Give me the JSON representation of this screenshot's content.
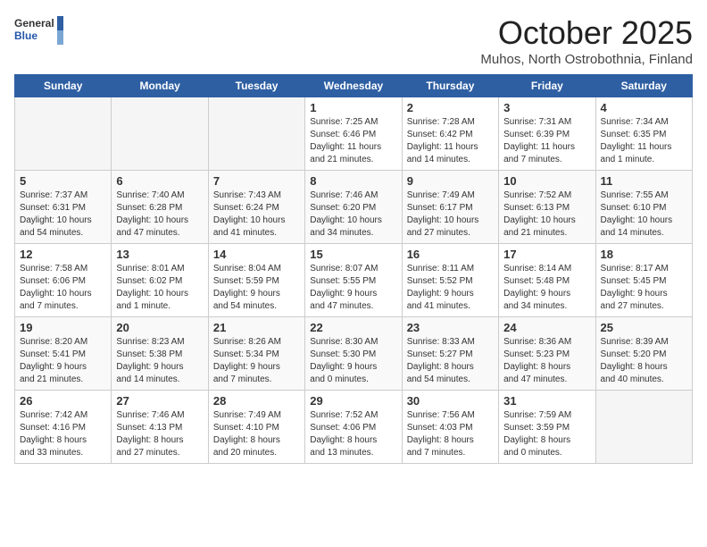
{
  "header": {
    "logo_general": "General",
    "logo_blue": "Blue",
    "month": "October 2025",
    "location": "Muhos, North Ostrobothnia, Finland"
  },
  "days_of_week": [
    "Sunday",
    "Monday",
    "Tuesday",
    "Wednesday",
    "Thursday",
    "Friday",
    "Saturday"
  ],
  "weeks": [
    [
      {
        "day": "",
        "info": ""
      },
      {
        "day": "",
        "info": ""
      },
      {
        "day": "",
        "info": ""
      },
      {
        "day": "1",
        "info": "Sunrise: 7:25 AM\nSunset: 6:46 PM\nDaylight: 11 hours\nand 21 minutes."
      },
      {
        "day": "2",
        "info": "Sunrise: 7:28 AM\nSunset: 6:42 PM\nDaylight: 11 hours\nand 14 minutes."
      },
      {
        "day": "3",
        "info": "Sunrise: 7:31 AM\nSunset: 6:39 PM\nDaylight: 11 hours\nand 7 minutes."
      },
      {
        "day": "4",
        "info": "Sunrise: 7:34 AM\nSunset: 6:35 PM\nDaylight: 11 hours\nand 1 minute."
      }
    ],
    [
      {
        "day": "5",
        "info": "Sunrise: 7:37 AM\nSunset: 6:31 PM\nDaylight: 10 hours\nand 54 minutes."
      },
      {
        "day": "6",
        "info": "Sunrise: 7:40 AM\nSunset: 6:28 PM\nDaylight: 10 hours\nand 47 minutes."
      },
      {
        "day": "7",
        "info": "Sunrise: 7:43 AM\nSunset: 6:24 PM\nDaylight: 10 hours\nand 41 minutes."
      },
      {
        "day": "8",
        "info": "Sunrise: 7:46 AM\nSunset: 6:20 PM\nDaylight: 10 hours\nand 34 minutes."
      },
      {
        "day": "9",
        "info": "Sunrise: 7:49 AM\nSunset: 6:17 PM\nDaylight: 10 hours\nand 27 minutes."
      },
      {
        "day": "10",
        "info": "Sunrise: 7:52 AM\nSunset: 6:13 PM\nDaylight: 10 hours\nand 21 minutes."
      },
      {
        "day": "11",
        "info": "Sunrise: 7:55 AM\nSunset: 6:10 PM\nDaylight: 10 hours\nand 14 minutes."
      }
    ],
    [
      {
        "day": "12",
        "info": "Sunrise: 7:58 AM\nSunset: 6:06 PM\nDaylight: 10 hours\nand 7 minutes."
      },
      {
        "day": "13",
        "info": "Sunrise: 8:01 AM\nSunset: 6:02 PM\nDaylight: 10 hours\nand 1 minute."
      },
      {
        "day": "14",
        "info": "Sunrise: 8:04 AM\nSunset: 5:59 PM\nDaylight: 9 hours\nand 54 minutes."
      },
      {
        "day": "15",
        "info": "Sunrise: 8:07 AM\nSunset: 5:55 PM\nDaylight: 9 hours\nand 47 minutes."
      },
      {
        "day": "16",
        "info": "Sunrise: 8:11 AM\nSunset: 5:52 PM\nDaylight: 9 hours\nand 41 minutes."
      },
      {
        "day": "17",
        "info": "Sunrise: 8:14 AM\nSunset: 5:48 PM\nDaylight: 9 hours\nand 34 minutes."
      },
      {
        "day": "18",
        "info": "Sunrise: 8:17 AM\nSunset: 5:45 PM\nDaylight: 9 hours\nand 27 minutes."
      }
    ],
    [
      {
        "day": "19",
        "info": "Sunrise: 8:20 AM\nSunset: 5:41 PM\nDaylight: 9 hours\nand 21 minutes."
      },
      {
        "day": "20",
        "info": "Sunrise: 8:23 AM\nSunset: 5:38 PM\nDaylight: 9 hours\nand 14 minutes."
      },
      {
        "day": "21",
        "info": "Sunrise: 8:26 AM\nSunset: 5:34 PM\nDaylight: 9 hours\nand 7 minutes."
      },
      {
        "day": "22",
        "info": "Sunrise: 8:30 AM\nSunset: 5:30 PM\nDaylight: 9 hours\nand 0 minutes."
      },
      {
        "day": "23",
        "info": "Sunrise: 8:33 AM\nSunset: 5:27 PM\nDaylight: 8 hours\nand 54 minutes."
      },
      {
        "day": "24",
        "info": "Sunrise: 8:36 AM\nSunset: 5:23 PM\nDaylight: 8 hours\nand 47 minutes."
      },
      {
        "day": "25",
        "info": "Sunrise: 8:39 AM\nSunset: 5:20 PM\nDaylight: 8 hours\nand 40 minutes."
      }
    ],
    [
      {
        "day": "26",
        "info": "Sunrise: 7:42 AM\nSunset: 4:16 PM\nDaylight: 8 hours\nand 33 minutes."
      },
      {
        "day": "27",
        "info": "Sunrise: 7:46 AM\nSunset: 4:13 PM\nDaylight: 8 hours\nand 27 minutes."
      },
      {
        "day": "28",
        "info": "Sunrise: 7:49 AM\nSunset: 4:10 PM\nDaylight: 8 hours\nand 20 minutes."
      },
      {
        "day": "29",
        "info": "Sunrise: 7:52 AM\nSunset: 4:06 PM\nDaylight: 8 hours\nand 13 minutes."
      },
      {
        "day": "30",
        "info": "Sunrise: 7:56 AM\nSunset: 4:03 PM\nDaylight: 8 hours\nand 7 minutes."
      },
      {
        "day": "31",
        "info": "Sunrise: 7:59 AM\nSunset: 3:59 PM\nDaylight: 8 hours\nand 0 minutes."
      },
      {
        "day": "",
        "info": ""
      }
    ]
  ]
}
